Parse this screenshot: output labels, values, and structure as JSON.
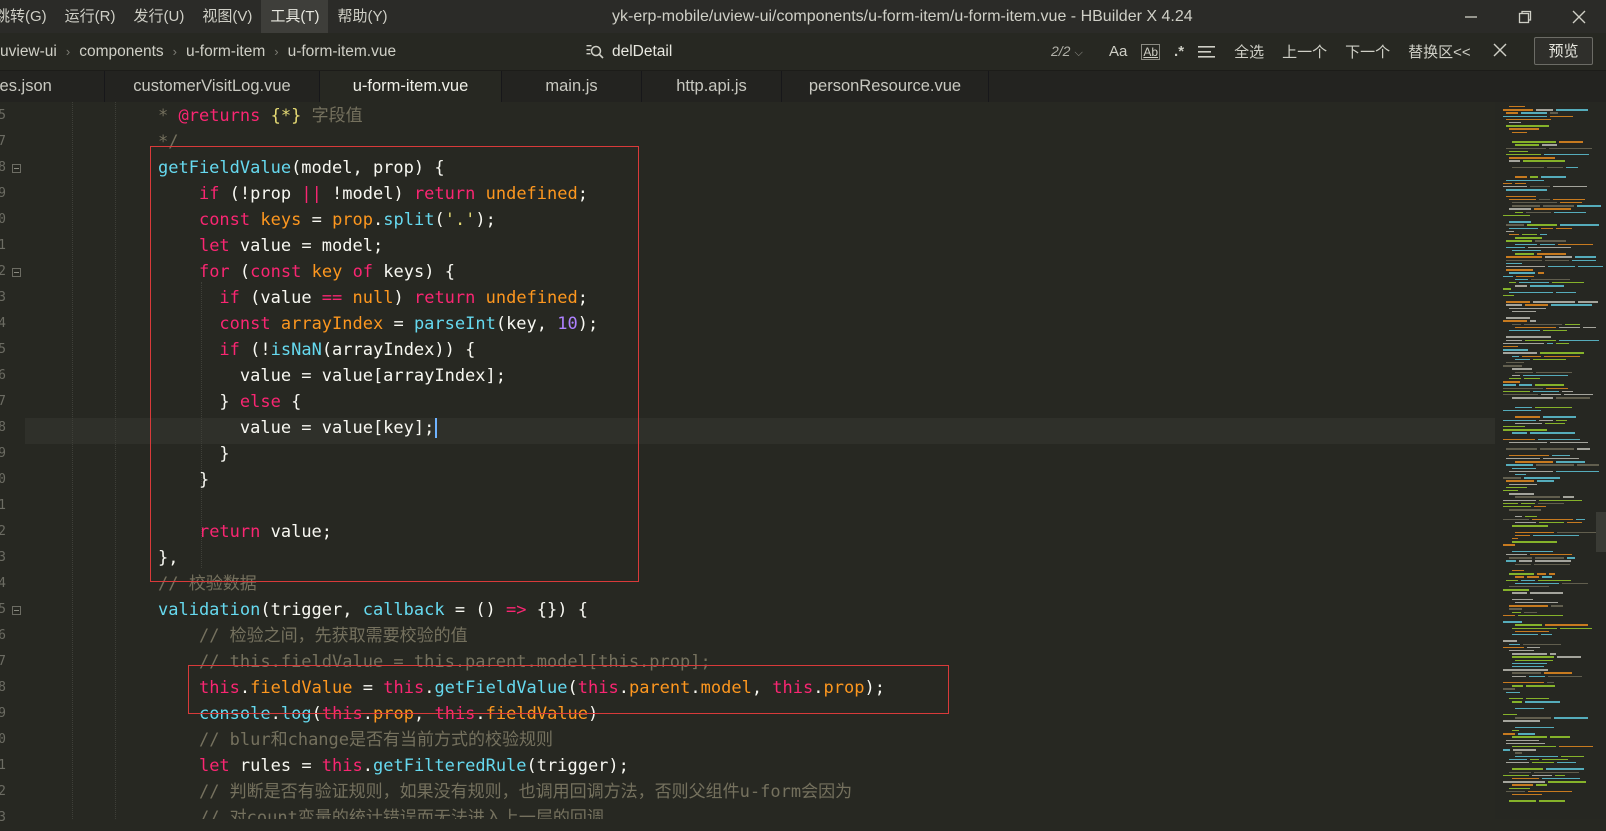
{
  "menu": {
    "items": [
      "跳转(G)",
      "运行(R)",
      "发行(U)",
      "视图(V)",
      "工具(T)",
      "帮助(Y)"
    ],
    "active_index": 4
  },
  "window": {
    "title": "yk-erp-mobile/uview-ui/components/u-form-item/u-form-item.vue - HBuilder X 4.24"
  },
  "breadcrumb": [
    "uview-ui",
    "components",
    "u-form-item",
    "u-form-item.vue"
  ],
  "find": {
    "query": "delDetail",
    "count": "2/2",
    "options": [
      "Aa",
      "Ab",
      ".*"
    ],
    "actions": [
      "全选",
      "上一个",
      "下一个",
      "替换区<<"
    ]
  },
  "preview_label": "预览",
  "tabs": [
    {
      "label": "pages.json",
      "active": false
    },
    {
      "label": "customerVisitLog.vue",
      "active": false
    },
    {
      "label": "u-form-item.vue",
      "active": true
    },
    {
      "label": "main.js",
      "active": false
    },
    {
      "label": "http.api.js",
      "active": false
    },
    {
      "label": "personResource.vue",
      "active": false
    }
  ],
  "line_numbers": [
    "5",
    "7",
    "8",
    "9",
    "0",
    "1",
    "2",
    "3",
    "4",
    "5",
    "6",
    "7",
    "8",
    "9",
    "0",
    "1",
    "2",
    "3",
    "4",
    "5",
    "6",
    "7",
    "8",
    "9",
    "0",
    "1",
    "2",
    "3"
  ],
  "colors": {
    "background": "#272822",
    "keyword": "#66d9ef",
    "function": "#a6e22e",
    "variable": "#fd971f",
    "operator": "#f92672",
    "string": "#e6db74",
    "number": "#ae81ff",
    "comment": "#75715e",
    "highlight_box": "#d83a3a"
  },
  "code": [
    [
      {
        "t": "* ",
        "c": "c"
      },
      {
        "t": "@returns",
        "c": "r"
      },
      {
        "t": " ",
        "c": "c"
      },
      {
        "t": "{*}",
        "c": "s"
      },
      {
        "t": " 字段值",
        "c": "c"
      }
    ],
    [
      {
        "t": "*/",
        "c": "c"
      }
    ],
    [
      {
        "t": "getFieldValue",
        "c": "k"
      },
      {
        "t": "(model, prop) {",
        "c": "p"
      }
    ],
    [
      {
        "t": "    "
      },
      {
        "t": "if",
        "c": "r"
      },
      {
        "t": " (!prop ",
        "c": "p"
      },
      {
        "t": "||",
        "c": "r"
      },
      {
        "t": " !model) ",
        "c": "p"
      },
      {
        "t": "return",
        "c": "r"
      },
      {
        "t": " ",
        "c": "p"
      },
      {
        "t": "undefined",
        "c": "v"
      },
      {
        "t": ";",
        "c": "p"
      }
    ],
    [
      {
        "t": "    "
      },
      {
        "t": "const",
        "c": "r"
      },
      {
        "t": " ",
        "c": "p"
      },
      {
        "t": "keys",
        "c": "v"
      },
      {
        "t": " = ",
        "c": "p"
      },
      {
        "t": "prop",
        "c": "v"
      },
      {
        "t": ".",
        "c": "p"
      },
      {
        "t": "split",
        "c": "k"
      },
      {
        "t": "(",
        "c": "p"
      },
      {
        "t": "'.'",
        "c": "s"
      },
      {
        "t": ");",
        "c": "p"
      }
    ],
    [
      {
        "t": "    "
      },
      {
        "t": "let",
        "c": "r"
      },
      {
        "t": " value = model;",
        "c": "p"
      }
    ],
    [
      {
        "t": "    "
      },
      {
        "t": "for",
        "c": "r"
      },
      {
        "t": " (",
        "c": "p"
      },
      {
        "t": "const",
        "c": "r"
      },
      {
        "t": " ",
        "c": "p"
      },
      {
        "t": "key",
        "c": "v"
      },
      {
        "t": " ",
        "c": "p"
      },
      {
        "t": "of",
        "c": "r"
      },
      {
        "t": " keys) {",
        "c": "p"
      }
    ],
    [
      {
        "t": "      "
      },
      {
        "t": "if",
        "c": "r"
      },
      {
        "t": " (value ",
        "c": "p"
      },
      {
        "t": "==",
        "c": "r"
      },
      {
        "t": " ",
        "c": "p"
      },
      {
        "t": "null",
        "c": "v"
      },
      {
        "t": ") ",
        "c": "p"
      },
      {
        "t": "return",
        "c": "r"
      },
      {
        "t": " ",
        "c": "p"
      },
      {
        "t": "undefined",
        "c": "v"
      },
      {
        "t": ";",
        "c": "p"
      }
    ],
    [
      {
        "t": "      "
      },
      {
        "t": "const",
        "c": "r"
      },
      {
        "t": " ",
        "c": "p"
      },
      {
        "t": "arrayIndex",
        "c": "v"
      },
      {
        "t": " = ",
        "c": "p"
      },
      {
        "t": "parseInt",
        "c": "k"
      },
      {
        "t": "(key, ",
        "c": "p"
      },
      {
        "t": "10",
        "c": "n"
      },
      {
        "t": ");",
        "c": "p"
      }
    ],
    [
      {
        "t": "      "
      },
      {
        "t": "if",
        "c": "r"
      },
      {
        "t": " (!",
        "c": "p"
      },
      {
        "t": "isNaN",
        "c": "k"
      },
      {
        "t": "(arrayIndex)) {",
        "c": "p"
      }
    ],
    [
      {
        "t": "        "
      },
      {
        "t": "value = value[arrayIndex];",
        "c": "p"
      }
    ],
    [
      {
        "t": "      "
      },
      {
        "t": "} ",
        "c": "p"
      },
      {
        "t": "else",
        "c": "r"
      },
      {
        "t": " {",
        "c": "p"
      }
    ],
    [
      {
        "t": "        "
      },
      {
        "t": "value = value[key];",
        "c": "p"
      },
      {
        "t": "",
        "c": "cursor"
      }
    ],
    [
      {
        "t": "      "
      },
      {
        "t": "}",
        "c": "p"
      }
    ],
    [
      {
        "t": "    "
      },
      {
        "t": "}",
        "c": "p"
      }
    ],
    [],
    [
      {
        "t": "    "
      },
      {
        "t": "return",
        "c": "r"
      },
      {
        "t": " value;",
        "c": "p"
      }
    ],
    [
      {
        "t": "},",
        "c": "p"
      }
    ],
    [
      {
        "t": "// 校验数据",
        "c": "c"
      }
    ],
    [
      {
        "t": "validation",
        "c": "k"
      },
      {
        "t": "(trigger, ",
        "c": "p"
      },
      {
        "t": "callback",
        "c": "k"
      },
      {
        "t": " = () ",
        "c": "p"
      },
      {
        "t": "=>",
        "c": "r"
      },
      {
        "t": " {}) {",
        "c": "p"
      }
    ],
    [
      {
        "t": "    "
      },
      {
        "t": "// 检验之间，先获取需要校验的值",
        "c": "c"
      }
    ],
    [
      {
        "t": "    "
      },
      {
        "t": "// this.fieldValue = this.parent.model[this.prop];",
        "c": "c"
      }
    ],
    [
      {
        "t": "    "
      },
      {
        "t": "this",
        "c": "r"
      },
      {
        "t": ".",
        "c": "p"
      },
      {
        "t": "fieldValue",
        "c": "v"
      },
      {
        "t": " = ",
        "c": "p"
      },
      {
        "t": "this",
        "c": "r"
      },
      {
        "t": ".",
        "c": "p"
      },
      {
        "t": "getFieldValue",
        "c": "k"
      },
      {
        "t": "(",
        "c": "p"
      },
      {
        "t": "this",
        "c": "r"
      },
      {
        "t": ".",
        "c": "p"
      },
      {
        "t": "parent",
        "c": "v"
      },
      {
        "t": ".",
        "c": "p"
      },
      {
        "t": "model",
        "c": "v"
      },
      {
        "t": ", ",
        "c": "p"
      },
      {
        "t": "this",
        "c": "r"
      },
      {
        "t": ".",
        "c": "p"
      },
      {
        "t": "prop",
        "c": "v"
      },
      {
        "t": ");",
        "c": "p"
      }
    ],
    [
      {
        "t": "    "
      },
      {
        "t": "console",
        "c": "k"
      },
      {
        "t": ".",
        "c": "p"
      },
      {
        "t": "log",
        "c": "k"
      },
      {
        "t": "(",
        "c": "p"
      },
      {
        "t": "this",
        "c": "r"
      },
      {
        "t": ".",
        "c": "p"
      },
      {
        "t": "prop",
        "c": "v"
      },
      {
        "t": ", ",
        "c": "p"
      },
      {
        "t": "this",
        "c": "r"
      },
      {
        "t": ".",
        "c": "p"
      },
      {
        "t": "fieldValue",
        "c": "v"
      },
      {
        "t": ")",
        "c": "p"
      }
    ],
    [
      {
        "t": "    "
      },
      {
        "t": "// blur和change是否有当前方式的校验规则",
        "c": "c"
      }
    ],
    [
      {
        "t": "    "
      },
      {
        "t": "let",
        "c": "r"
      },
      {
        "t": " rules = ",
        "c": "p"
      },
      {
        "t": "this",
        "c": "r"
      },
      {
        "t": ".",
        "c": "p"
      },
      {
        "t": "getFilteredRule",
        "c": "k"
      },
      {
        "t": "(trigger);",
        "c": "p"
      }
    ],
    [
      {
        "t": "    "
      },
      {
        "t": "// 判断是否有验证规则，如果没有规则，也调用回调方法，否则父组件u-form会因为",
        "c": "c"
      }
    ],
    [
      {
        "t": "    "
      },
      {
        "t": "// 对count变量的统计错误而无法进入上一层的回调",
        "c": "c"
      }
    ]
  ]
}
